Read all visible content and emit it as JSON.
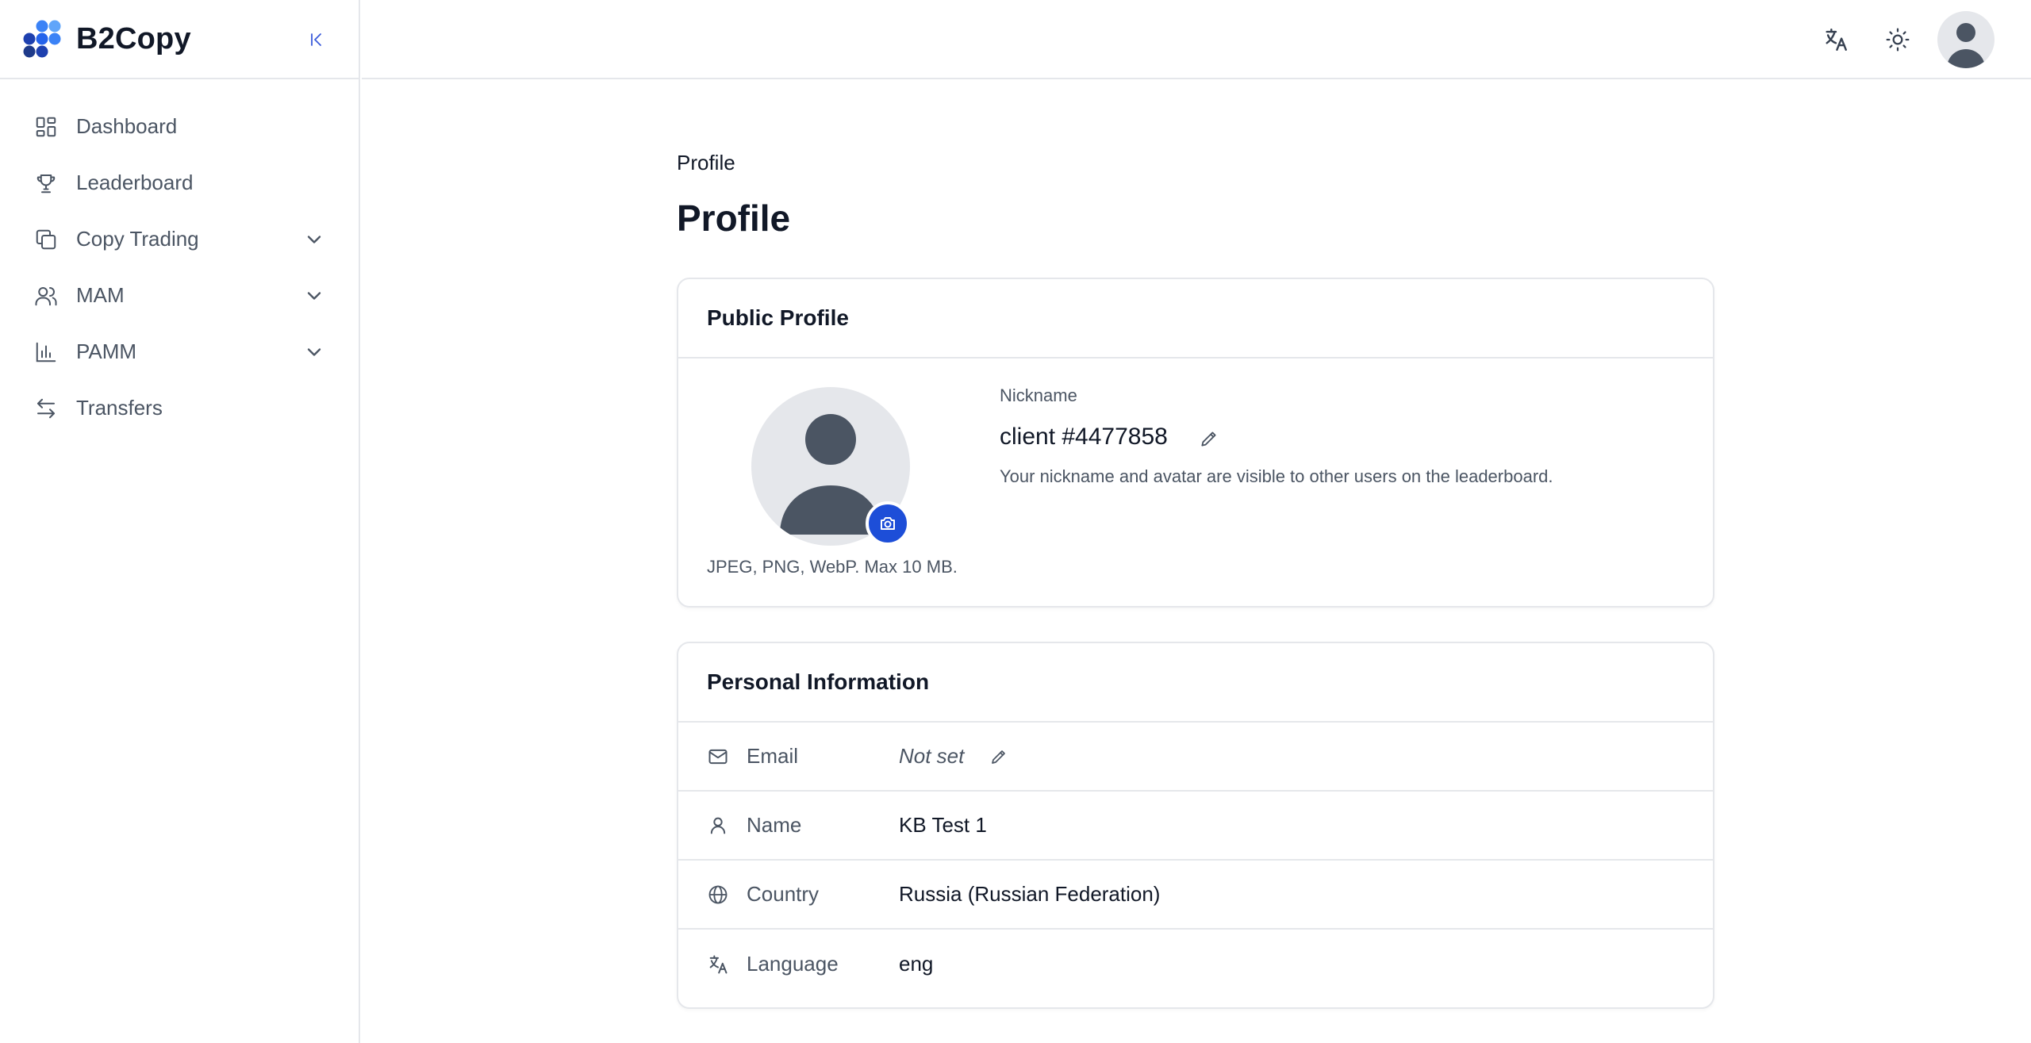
{
  "app": {
    "brand": "B2Copy"
  },
  "sidebar": {
    "items": [
      {
        "label": "Dashboard",
        "icon": "dashboard-icon"
      },
      {
        "label": "Leaderboard",
        "icon": "trophy-icon"
      },
      {
        "label": "Copy Trading",
        "icon": "copy-icon",
        "expandable": true
      },
      {
        "label": "MAM",
        "icon": "users-icon",
        "expandable": true
      },
      {
        "label": "PAMM",
        "icon": "bar-chart-icon",
        "expandable": true
      },
      {
        "label": "Transfers",
        "icon": "transfer-arrows-icon"
      }
    ]
  },
  "topbar": {
    "icons": [
      "translate-icon",
      "sun-icon",
      "user-avatar"
    ]
  },
  "breadcrumb": "Profile",
  "page_title": "Profile",
  "public_profile": {
    "title": "Public Profile",
    "avatar_hint": "JPEG, PNG, WebP. Max 10 MB.",
    "nickname_label": "Nickname",
    "nickname_value": "client #4477858",
    "nickname_desc": "Your nickname and avatar are visible to other users on the leaderboard."
  },
  "personal_info": {
    "title": "Personal Information",
    "rows": [
      {
        "label": "Email",
        "value": "Not set",
        "icon": "mail-icon"
      },
      {
        "label": "Name",
        "value": "KB Test 1",
        "icon": "user-icon"
      },
      {
        "label": "Country",
        "value": "Russia (Russian Federation)",
        "icon": "globe-icon"
      },
      {
        "label": "Language",
        "value": "eng",
        "icon": "translate-icon"
      }
    ]
  },
  "colors": {
    "accent": "#1d4ed8",
    "logo_dark": "#1e3a8a",
    "logo_light": "#3b82f6",
    "border": "#e5e7eb",
    "muted_text": "#4b5563"
  }
}
